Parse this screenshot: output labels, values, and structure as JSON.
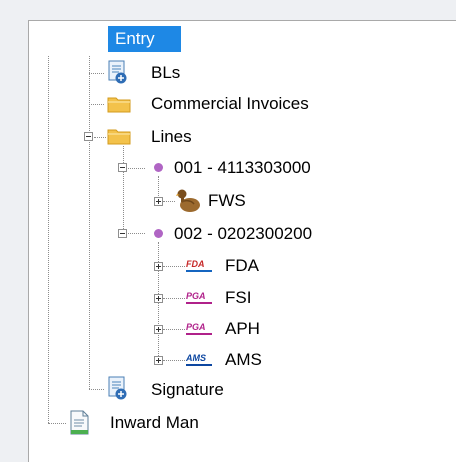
{
  "tree": {
    "root": {
      "label": "Entry"
    },
    "bls": {
      "label": "BLs"
    },
    "commercial_invoices": {
      "label": "Commercial Invoices"
    },
    "lines": {
      "label": "Lines"
    },
    "line_001": {
      "label": "001 - 4113303000"
    },
    "fws": {
      "label": "FWS"
    },
    "line_002": {
      "label": "002 - 0202300200"
    },
    "fda": {
      "label": "FDA",
      "badge": "FDA"
    },
    "fsi": {
      "label": "FSI",
      "badge": "PGA"
    },
    "aph": {
      "label": "APH",
      "badge": "PGA"
    },
    "ams": {
      "label": "AMS",
      "badge": "AMS"
    },
    "signature": {
      "label": "Signature"
    },
    "inward_man": {
      "label": "Inward Man"
    }
  },
  "colors": {
    "selection": "#1e88e5",
    "bullet": "#b065c4",
    "folder": "#f3c24b"
  }
}
